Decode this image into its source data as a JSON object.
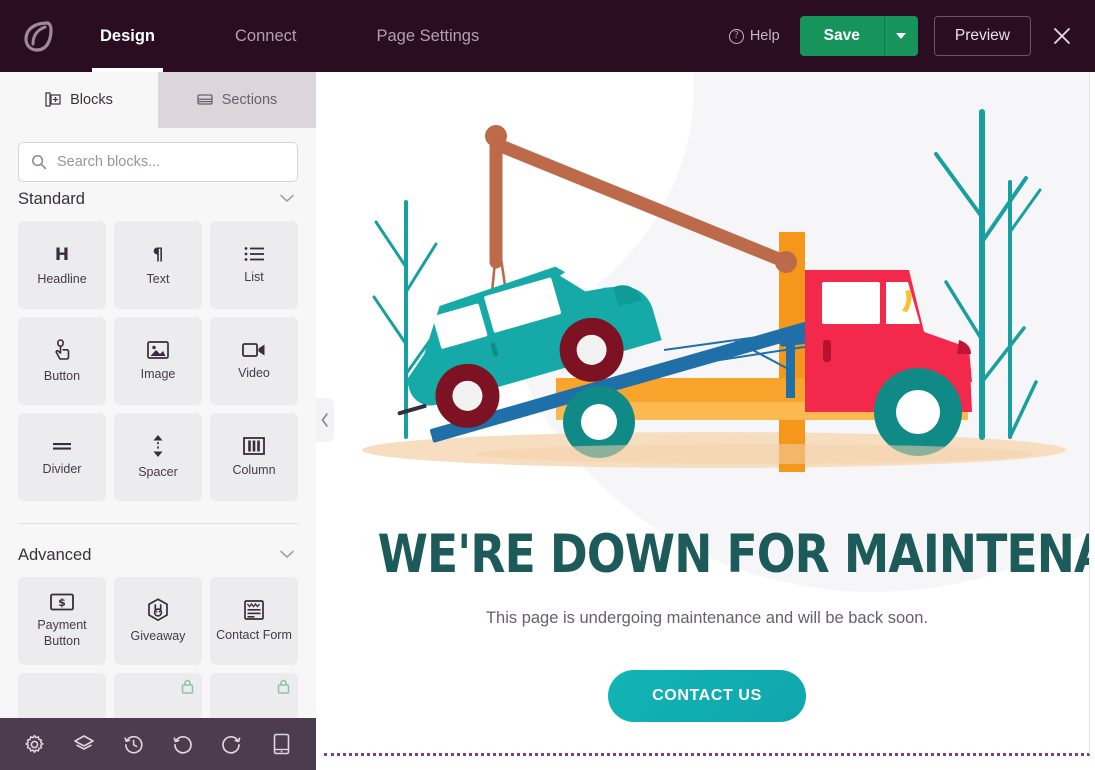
{
  "header": {
    "logo_icon": "leaf-logo-icon",
    "nav": [
      {
        "label": "Design",
        "active": true
      },
      {
        "label": "Connect",
        "active": false
      },
      {
        "label": "Page Settings",
        "active": false
      }
    ],
    "help_label": "Help",
    "help_icon": "question-circle-icon",
    "save_label": "Save",
    "save_caret_icon": "chevron-down-icon",
    "preview_label": "Preview",
    "close_icon": "close-icon",
    "accent_save_color": "#17945b",
    "bar_color": "#2b0d22"
  },
  "sidebar": {
    "tabs": [
      {
        "label": "Blocks",
        "icon": "blocks-icon",
        "active": true
      },
      {
        "label": "Sections",
        "icon": "sections-icon",
        "active": false
      }
    ],
    "search": {
      "placeholder": "Search blocks...",
      "value": "",
      "icon": "search-icon"
    },
    "groups": [
      {
        "title": "Standard",
        "chevron_icon": "chevron-down-icon",
        "blocks": [
          {
            "label": "Headline",
            "icon": "headline-h-icon",
            "locked": false
          },
          {
            "label": "Text",
            "icon": "paragraph-pilcrow-icon",
            "locked": false
          },
          {
            "label": "List",
            "icon": "list-icon",
            "locked": false
          },
          {
            "label": "Button",
            "icon": "pointer-hand-icon",
            "locked": false
          },
          {
            "label": "Image",
            "icon": "image-icon",
            "locked": false
          },
          {
            "label": "Video",
            "icon": "video-camera-icon",
            "locked": false
          },
          {
            "label": "Divider",
            "icon": "divider-icon",
            "locked": false
          },
          {
            "label": "Spacer",
            "icon": "spacer-arrows-icon",
            "locked": false
          },
          {
            "label": "Column",
            "icon": "columns-icon",
            "locked": false
          }
        ]
      },
      {
        "title": "Advanced",
        "chevron_icon": "chevron-down-icon",
        "blocks": [
          {
            "label": "Payment Button",
            "icon": "payment-dollar-icon",
            "locked": false
          },
          {
            "label": "Giveaway",
            "icon": "giveaway-bunny-icon",
            "locked": false
          },
          {
            "label": "Contact Form",
            "icon": "contact-form-icon",
            "locked": false
          },
          {
            "label": "",
            "icon": "",
            "locked": false
          },
          {
            "label": "",
            "icon": "",
            "locked": true
          },
          {
            "label": "",
            "icon": "",
            "locked": true
          }
        ]
      }
    ],
    "bottom_toolbar": [
      {
        "icon": "gear-settings-icon",
        "name": "settings"
      },
      {
        "icon": "layers-icon",
        "name": "layers"
      },
      {
        "icon": "history-clock-icon",
        "name": "history"
      },
      {
        "icon": "undo-icon",
        "name": "undo"
      },
      {
        "icon": "redo-icon",
        "name": "redo"
      },
      {
        "icon": "mobile-device-icon",
        "name": "device-preview"
      }
    ],
    "collapse_icon": "chevron-left-icon"
  },
  "canvas": {
    "illustration": {
      "name": "tow-truck-maintenance-illustration",
      "colors": {
        "car_body": "#15aaa8",
        "car_wheel": "#7c1222",
        "ramp": "#1f6fa8",
        "truck_bed": "#f9a42c",
        "truck_cab": "#f2294b",
        "truck_wheel": "#108a86",
        "crane_arm": "#bd6a4a",
        "crane_post": "#f79a1e",
        "tree": "#18a0a0",
        "ground": "#f6dbbb"
      }
    },
    "heading": "WE'RE DOWN FOR MAINTENANCE",
    "subheading": "This page is undergoing maintenance and will be back soon.",
    "cta_label": "CONTACT US",
    "heading_color": "#1d5b5b",
    "cta_color": "#12b4b4"
  }
}
